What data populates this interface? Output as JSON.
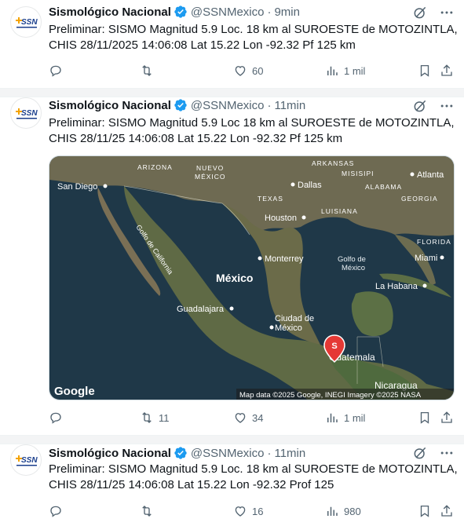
{
  "tweets": [
    {
      "avatar_text": "SSN",
      "name": "Sismológico Nacional",
      "handle": "@SSNMexico",
      "time": "9min",
      "lines": [
        "Preliminar: SISMO Magnitud 5.9 Loc. 18 km al SUROESTE de MOTOZINTLA,",
        "CHIS 28/11/2025 14:06:08 Lat 15.22 Lon -92.32 Pf 125 km"
      ],
      "replies": "",
      "retweets": "",
      "likes": "60",
      "views": "1 mil"
    },
    {
      "avatar_text": "SSN",
      "name": "Sismológico Nacional",
      "handle": "@SSNMexico",
      "time": "11min",
      "lines": [
        "Preliminar: SISMO Magnitud 5.9 Loc  18 km al SUROESTE de MOTOZINTLA,",
        "CHIS 28/11/25 14:06:08 Lat 15.22 Lon -92.32 Pf 125 km"
      ],
      "replies": "",
      "retweets": "11",
      "likes": "34",
      "views": "1 mil",
      "map": {
        "google_logo": "Google",
        "attribution": "Map data ©2025 Google, INEGI Imagery ©2025 NASA",
        "marker_letter": "S",
        "labels": {
          "arizona": "ARIZONA",
          "nuevo_mexico_1": "NUEVO",
          "nuevo_mexico_2": "MÉXICO",
          "arkansas": "ARKANSAS",
          "misisipi": "MISISIPI",
          "alabama": "ALABAMA",
          "georgia": "GEORGIA",
          "atlanta": "Atlanta",
          "san_diego": "San Diego",
          "dallas": "Dallas",
          "texas": "TEXAS",
          "luisiana": "LUISIANA",
          "houston": "Houston",
          "florida": "FLORIDA",
          "golfo_california": "Golfo de California",
          "monterrey": "Monterrey",
          "golfo_mexico_1": "Golfo de",
          "golfo_mexico_2": "México",
          "miami": "Miami",
          "mexico": "México",
          "la_habana": "La Habana",
          "guadalajara": "Guadalajara",
          "ciudad_mexico_1": "Ciudad de",
          "ciudad_mexico_2": "México",
          "guatemala": "Guatemala",
          "nicaragua": "Nicaragua"
        }
      }
    },
    {
      "avatar_text": "SSN",
      "name": "Sismológico Nacional",
      "handle": "@SSNMexico",
      "time": "11min",
      "lines": [
        "Preliminar: SISMO Magnitud 5.9 Loc. 18 km al SUROESTE de MOTOZINTLA,",
        "CHIS 28/11/25 14:06:08 Lat 15.22 Lon -92.32 Prof 125"
      ],
      "replies": "",
      "retweets": "",
      "likes": "16",
      "views": "980"
    }
  ],
  "colors": {
    "verified": "#1d9bf0",
    "text_secondary": "#536471",
    "ssn_blue": "#1a3e8c",
    "ssn_orange": "#f4a300",
    "marker": "#e53935"
  },
  "icons": [
    "reply-icon",
    "retweet-icon",
    "like-icon",
    "views-icon",
    "bookmark-icon",
    "share-icon",
    "grok-icon",
    "more-icon",
    "verified-badge-icon"
  ]
}
